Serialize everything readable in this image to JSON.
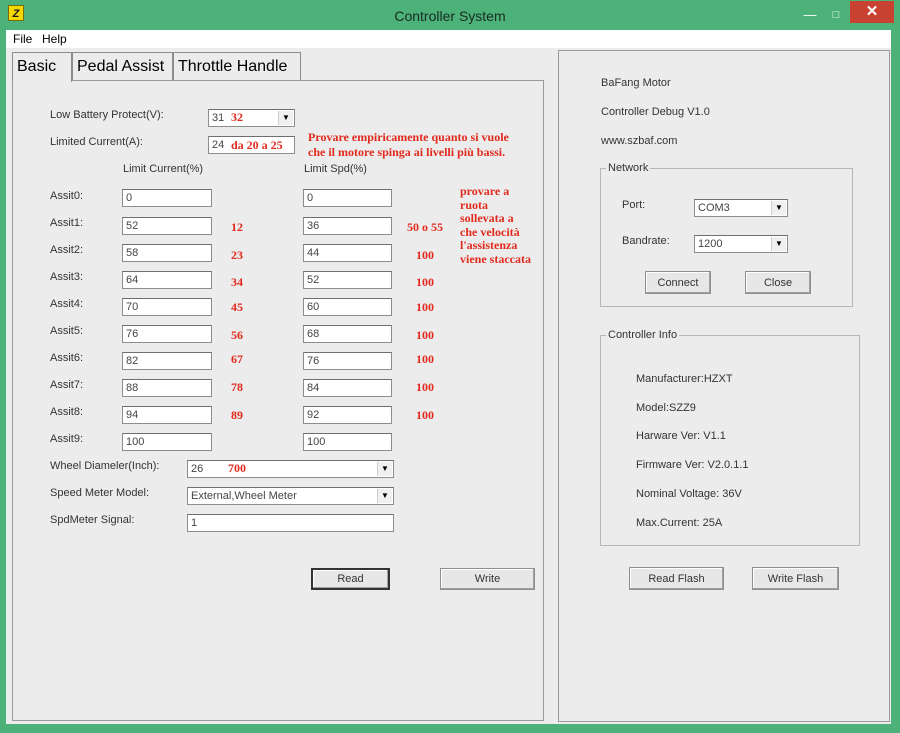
{
  "window": {
    "title": "Controller System",
    "icon_label": "Z"
  },
  "menu": [
    "File",
    "Help"
  ],
  "tabs": [
    "Basic",
    "Pedal Assist",
    "Throttle Handle"
  ],
  "basic": {
    "low_battery_label": "Low Battery Protect(V):",
    "low_battery_value": "31",
    "low_battery_note": "32",
    "limited_current_label": "Limited Current(A):",
    "limited_current_value": "24",
    "limited_current_note": "da 20 a 25",
    "note_line1": "Provare empiricamente quanto si vuole",
    "note_line2": "che il motore spinga ai livelli più bassi.",
    "col_current": "Limit Current(%)",
    "col_speed": "Limit Spd(%)",
    "speed_note": [
      "provare a",
      "ruota",
      "sollevata a",
      "che velocità",
      "l'assistenza",
      "viene staccata"
    ],
    "assists": [
      {
        "label": "Assit0:",
        "current": "0",
        "speed": "0",
        "current_note": "",
        "speed_note": ""
      },
      {
        "label": "Assit1:",
        "current": "52",
        "speed": "36",
        "current_note": "12",
        "speed_note": "50 o 55"
      },
      {
        "label": "Assit2:",
        "current": "58",
        "speed": "44",
        "current_note": "23",
        "speed_note": "100"
      },
      {
        "label": "Assit3:",
        "current": "64",
        "speed": "52",
        "current_note": "34",
        "speed_note": "100"
      },
      {
        "label": "Assit4:",
        "current": "70",
        "speed": "60",
        "current_note": "45",
        "speed_note": "100"
      },
      {
        "label": "Assit5:",
        "current": "76",
        "speed": "68",
        "current_note": "56",
        "speed_note": "100"
      },
      {
        "label": "Assit6:",
        "current": "82",
        "speed": "76",
        "current_note": "67",
        "speed_note": "100"
      },
      {
        "label": "Assit7:",
        "current": "88",
        "speed": "84",
        "current_note": "78",
        "speed_note": "100"
      },
      {
        "label": "Assit8:",
        "current": "94",
        "speed": "92",
        "current_note": "89",
        "speed_note": "100"
      },
      {
        "label": "Assit9:",
        "current": "100",
        "speed": "100",
        "current_note": "",
        "speed_note": ""
      }
    ],
    "wheel_label": "Wheel Diameler(Inch):",
    "wheel_value": "26",
    "wheel_note": "700",
    "speedmeter_label": "Speed Meter Model:",
    "speedmeter_value": "External,Wheel Meter",
    "spdsignal_label": "SpdMeter Signal:",
    "spdsignal_value": "1",
    "read_label": "Read",
    "write_label": "Write"
  },
  "info": {
    "brand": "BaFang Motor",
    "version": "Controller Debug V1.0",
    "website": "www.szbaf.com"
  },
  "network": {
    "legend": "Network",
    "port_label": "Port:",
    "port_value": "COM3",
    "baud_label": "Bandrate:",
    "baud_value": "1200",
    "connect_label": "Connect",
    "close_label": "Close"
  },
  "controller_info": {
    "legend": "Controller Info",
    "lines": [
      "Manufacturer:HZXT",
      "Model:SZZ9",
      "Harware Ver: V1.1",
      "Firmware Ver: V2.0.1.1",
      "Nominal Voltage: 36V",
      "Max.Current: 25A"
    ]
  },
  "flash": {
    "read_label": "Read Flash",
    "write_label": "Write Flash"
  }
}
